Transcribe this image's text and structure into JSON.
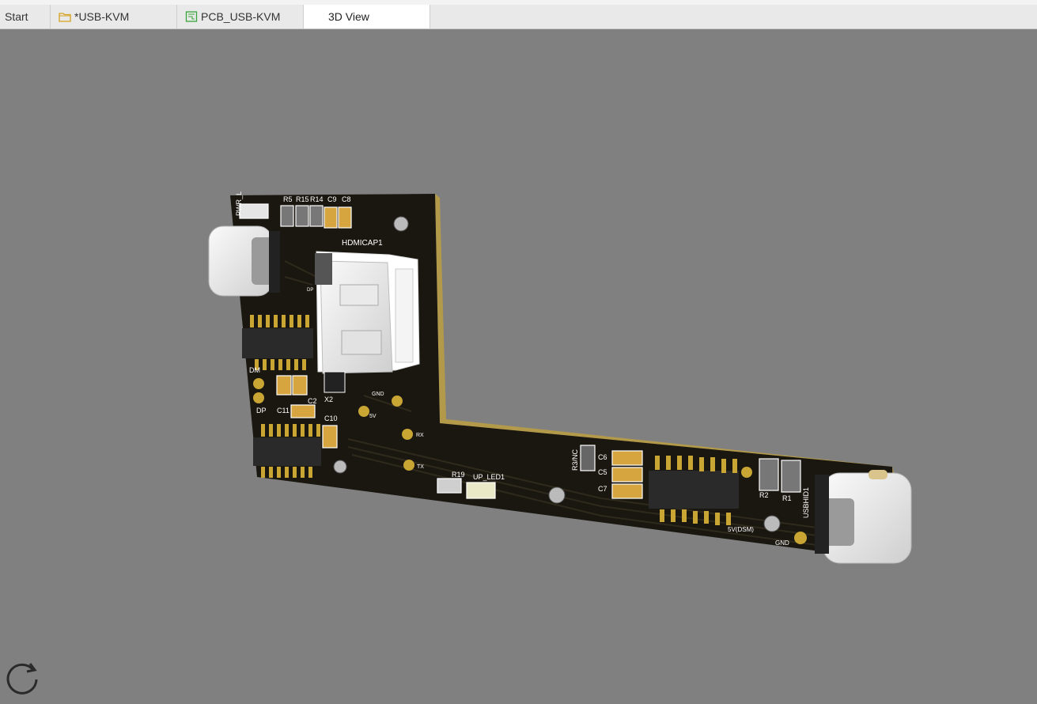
{
  "tabs": [
    {
      "label": "Start",
      "icon": "none"
    },
    {
      "label": "*USB-KVM",
      "icon": "folder-icon"
    },
    {
      "label": "PCB_USB-KVM",
      "icon": "pcb-icon"
    },
    {
      "label": "3D View",
      "icon": "none",
      "active": true
    }
  ],
  "colors": {
    "background": "#808080",
    "board": "#1a1710",
    "pad_gold": "#c9a534",
    "folder": "#d6a21e",
    "pcb_icon": "#3aa53a"
  },
  "silkscreen": {
    "pwr": "PWR_L",
    "r5": "R5",
    "r15": "R15",
    "r14": "R14",
    "c9": "C9",
    "c8": "C8",
    "hdmicap": "HDMICAP1",
    "dm": "DM",
    "dp": "DP",
    "dp2": "DP",
    "c11": "C11",
    "c2": "C2",
    "c10": "C10",
    "x2": "X2",
    "gnd1": "GND",
    "v5": "5V",
    "rx": "RX",
    "tx": "TX",
    "r19": "R19",
    "up_led": "UP_LED1",
    "r3nc": "R3/NC",
    "c6": "C6",
    "c5": "C5",
    "c7": "C7",
    "r2": "R2",
    "r1": "R1",
    "usbhid": "USBHID1",
    "v5dsm": "5V(DSM)",
    "gnd2": "GND"
  },
  "controls": {
    "refresh": "refresh-icon"
  }
}
